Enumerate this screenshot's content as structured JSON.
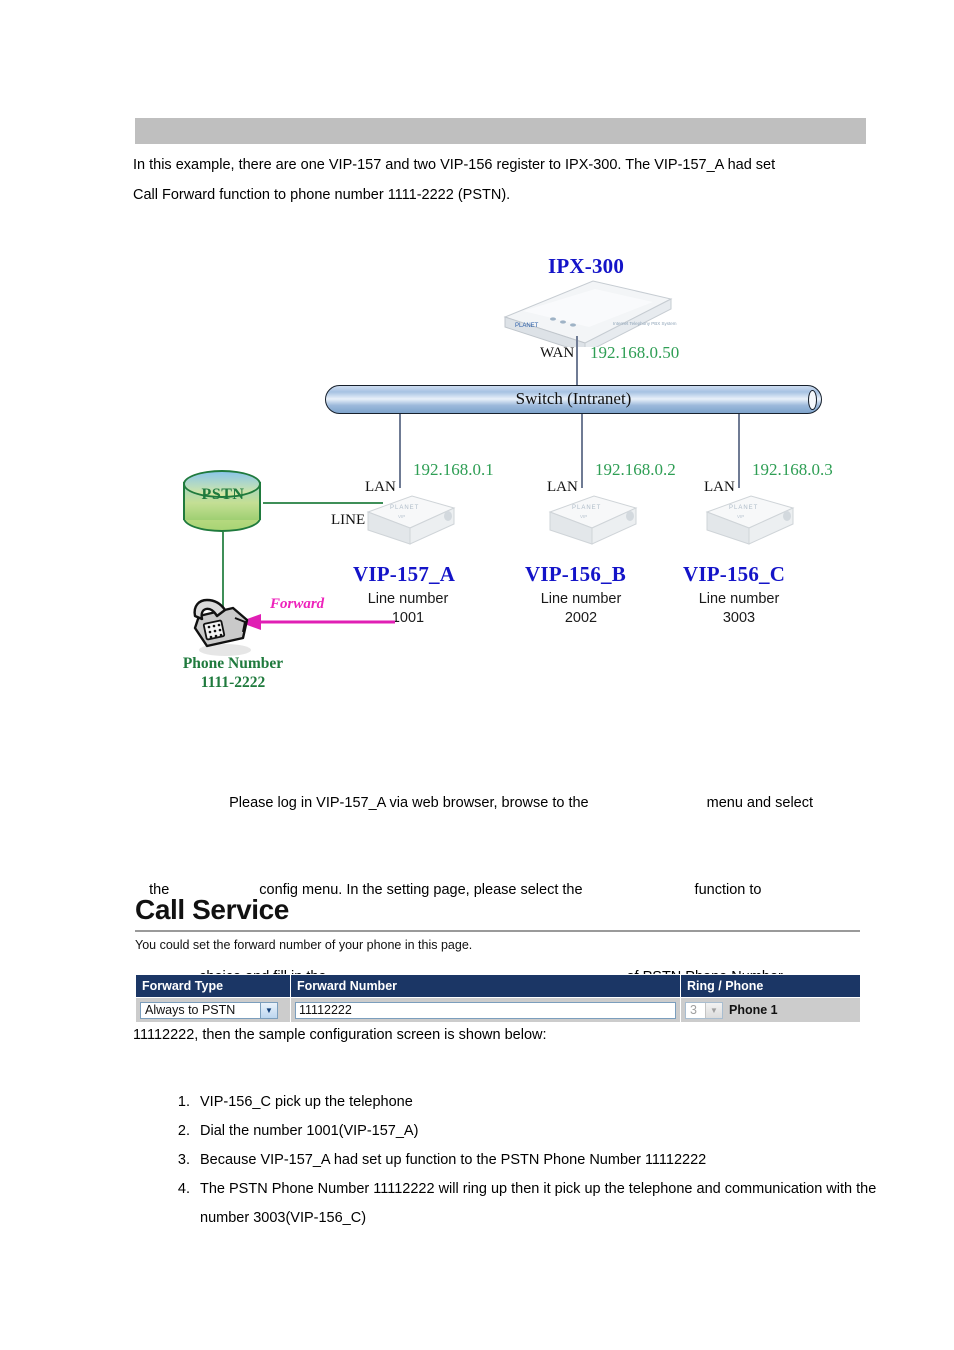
{
  "banner": {
    "text": ""
  },
  "intro": {
    "line1": "In this example, there are one VIP-157 and two VIP-156 register to IPX-300. The VIP-157_A had set",
    "line2": "Call Forward function to phone number 1111-2222 (PSTN)."
  },
  "diagram": {
    "ipx": {
      "title": "IPX-300",
      "port": "WAN",
      "ip": "192.168.0.50"
    },
    "switch": {
      "label": "Switch (Intranet)"
    },
    "pstn": {
      "label": "PSTN"
    },
    "phone": {
      "line1": "Phone Number",
      "line2": "1111-2222",
      "forward_label": "Forward"
    },
    "devices": [
      {
        "title": "VIP-157_A",
        "sub1": "Line number",
        "sub2": "1001",
        "ip": "192.168.0.1",
        "lan": "LAN",
        "line_port": "LINE"
      },
      {
        "title": "VIP-156_B",
        "sub1": "Line number",
        "sub2": "2002",
        "ip": "192.168.0.2",
        "lan": "LAN"
      },
      {
        "title": "VIP-156_C",
        "sub1": "Line number",
        "sub2": "3003",
        "ip": "192.168.0.3",
        "lan": "LAN"
      }
    ]
  },
  "explain": {
    "l1a": "Please log in VIP-157_A via web browser, browse to the",
    "l1b": "menu and select",
    "l2a": "the",
    "l2b": "config menu. In the setting page, please select the",
    "l2c": "function to",
    "l3a": "choice and fill in the",
    "l3b": "of PSTN Phone Number",
    "l4": "11112222, then the sample configuration screen is shown below:"
  },
  "call_service": {
    "title": "Call Service",
    "description": "You could set the forward number of your phone in this page.",
    "columns": [
      "Forward Type",
      "Forward Number",
      "Ring / Phone"
    ],
    "forward_type_value": "Always to PSTN",
    "forward_number_value": "11112222",
    "ring_value": "3",
    "phone_label": "Phone 1",
    "header_bg": "#1b3665",
    "row_bg": "#cccccc"
  },
  "steps": [
    "VIP-156_C pick up the telephone",
    "Dial the number 1001(VIP-157_A)",
    "Because VIP-157_A had set up                         function to the PSTN Phone Number 11112222",
    "The PSTN Phone Number 11112222 will ring up then it pick up the telephone and communication with the number 3003(VIP-156_C)"
  ]
}
